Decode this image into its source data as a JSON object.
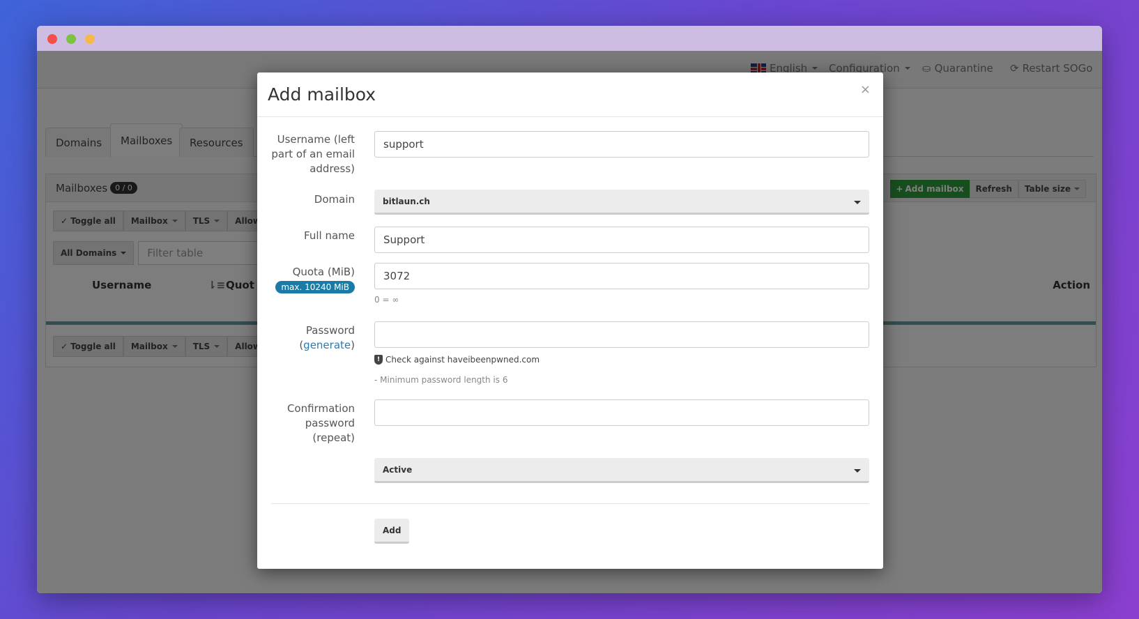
{
  "topnav": {
    "language": "English",
    "configuration": "Configuration",
    "quarantine": "Quarantine",
    "restart": "Restart SOGo"
  },
  "tabs": [
    "Domains",
    "Mailboxes",
    "Resources"
  ],
  "panel": {
    "title": "Mailboxes",
    "count": "0 / 0",
    "add_mailbox": "Add mailbox",
    "refresh": "Refresh",
    "table_size": "Table size",
    "toggle_all": "Toggle all",
    "mailbox": "Mailbox",
    "tls": "TLS",
    "allowed": "Allowed p",
    "all_domains": "All Domains",
    "filter_placeholder": "Filter table",
    "col_username": "Username",
    "col_quota": "Quot",
    "col_action": "Action"
  },
  "modal": {
    "title": "Add mailbox",
    "close": "×",
    "username_label": "Username (left part of an email address)",
    "username_value": "support",
    "domain_label": "Domain",
    "domain_value": "bitlaun.ch",
    "fullname_label": "Full name",
    "fullname_value": "Support",
    "quota_label": "Quota (MiB)",
    "quota_badge": "max. 10240 MiB",
    "quota_value": "3072",
    "quota_help": "0 = ∞",
    "password_label": "Password",
    "generate_link": "generate",
    "check_pwned": "Check against haveibeenpwned.com",
    "password_help": "- Minimum password length is 6",
    "confirm_label": "Confirmation password (repeat)",
    "status_value": "Active",
    "add_button": "Add"
  }
}
